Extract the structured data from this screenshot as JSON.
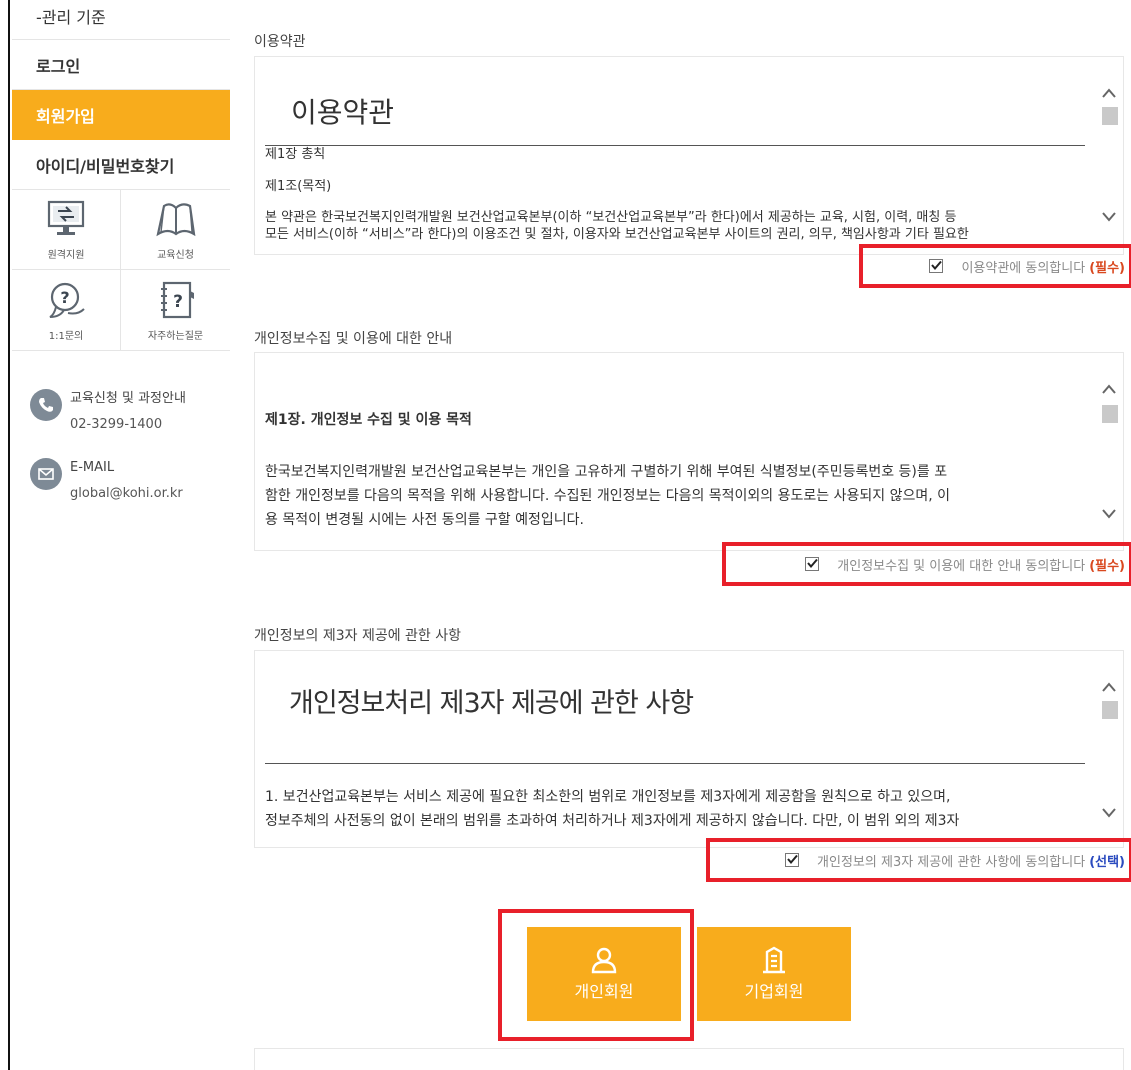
{
  "sidebar": {
    "top_item": "-관리 기준",
    "items": [
      {
        "label": "로그인"
      },
      {
        "label": "회원가입"
      },
      {
        "label": "아이디/비밀번호찾기"
      }
    ],
    "quick_links": [
      {
        "label": "원격지원",
        "icon": "remote-support-icon"
      },
      {
        "label": "교육신청",
        "icon": "open-book-icon"
      },
      {
        "label": "1:1문의",
        "icon": "question-bubble-icon"
      },
      {
        "label": "자주하는질문",
        "icon": "faq-notebook-icon"
      }
    ],
    "contact": {
      "phone_label": "교육신청 및 과정안내",
      "phone": "02-3299-1400",
      "email_label": "E-MAIL",
      "email": "global@kohi.or.kr"
    }
  },
  "terms": {
    "section_title": "이용약관",
    "heading": "이용약관",
    "chapter": "제1장 총칙",
    "article": "제1조(목적)",
    "body_line1": "본 약관은 한국보건복지인력개발원 보건산업교육본부(이하 “보건산업교육본부”라 한다)에서 제공하는 교육, 시험, 이력, 매칭 등",
    "body_line2": "모든 서비스(이하 “서비스”라 한다)의 이용조건 및 절차, 이용자와 보건산업교육본부 사이트의 권리, 의무, 책임사항과 기타 필요한",
    "agree_label": "이용약관에 동의합니다",
    "agree_tag": "(필수)",
    "checked": true
  },
  "privacy": {
    "section_title": "개인정보수집 및 이용에 대한 안내",
    "heading": "제1장. 개인정보 수집 및 이용 목적",
    "body_line1": "한국보건복지인력개발원 보건산업교육본부는 개인을 고유하게 구별하기 위해 부여된 식별정보(주민등록번호 등)를 포",
    "body_line2": "함한 개인정보를 다음의 목적을 위해 사용합니다. 수집된 개인정보는 다음의 목적이외의 용도로는 사용되지 않으며, 이",
    "body_line3": "용 목적이 변경될 시에는 사전 동의를 구할 예정입니다.",
    "agree_label": "개인정보수집 및 이용에 대한 안내 동의합니다",
    "agree_tag": "(필수)",
    "checked": true
  },
  "third_party": {
    "section_title": "개인정보의 제3자 제공에 관한 사항",
    "heading": "개인정보처리 제3자 제공에 관한 사항",
    "body_line1": "1. 보건산업교육본부는 서비스 제공에 필요한 최소한의 범위로 개인정보를 제3자에게 제공함을 원칙으로 하고 있으며,",
    "body_line2": "정보주체의 사전동의 없이 본래의 범위를 초과하여 처리하거나 제3자에게 제공하지 않습니다. 다만, 이 범위 외의 제3자",
    "agree_label": "개인정보의 제3자 제공에 관한 사항에 동의합니다",
    "agree_tag": "(선택)",
    "checked": true
  },
  "buttons": {
    "personal": "개인회원",
    "corporate": "기업회원"
  },
  "colors": {
    "accent": "#f8ac1c",
    "highlight": "#e8202a",
    "required": "#d9481f",
    "optional": "#2b4bbf"
  }
}
